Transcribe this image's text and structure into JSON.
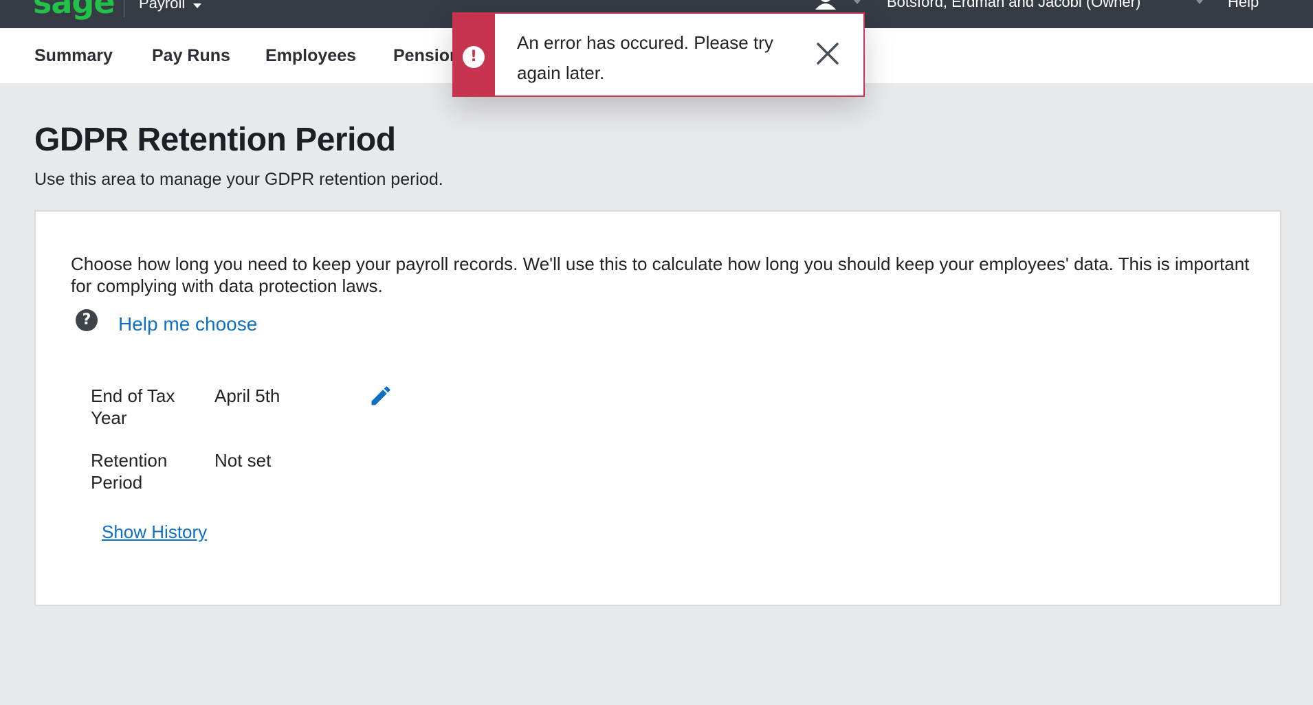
{
  "topbar": {
    "logo": "sage",
    "product": "Payroll",
    "company": "Botsford, Erdman and Jacobi (Owner)",
    "help": "Help",
    "icons": [
      "user-icon",
      "chevron-down-icon"
    ]
  },
  "nav": {
    "items": [
      "Summary",
      "Pay Runs",
      "Employees",
      "Pensions"
    ]
  },
  "page": {
    "title": "GDPR Retention Period",
    "subtitle": "Use this area to manage your GDPR retention period."
  },
  "card": {
    "description": "Choose how long you need to keep your payroll records. We'll use this to calculate how long you should keep your employees' data. This is important for complying with data protection laws.",
    "help_link": "Help me choose",
    "help_icon": "question-icon",
    "rows": [
      {
        "label": "End of Tax Year",
        "value": "April 5th"
      },
      {
        "label": "Retention Period",
        "value": "Not set"
      }
    ],
    "edit_icon": "pencil-icon",
    "history_link": "Show History"
  },
  "toast": {
    "message": "An error has occured. Please try again later.",
    "icon": "error-icon",
    "close_icon": "close-icon"
  },
  "colors": {
    "topbar_bg": "#363b44",
    "brand_green": "#22c24a",
    "link_blue": "#0f6fc0",
    "error_red": "#c7344f",
    "page_bg": "#e8e9eb"
  }
}
